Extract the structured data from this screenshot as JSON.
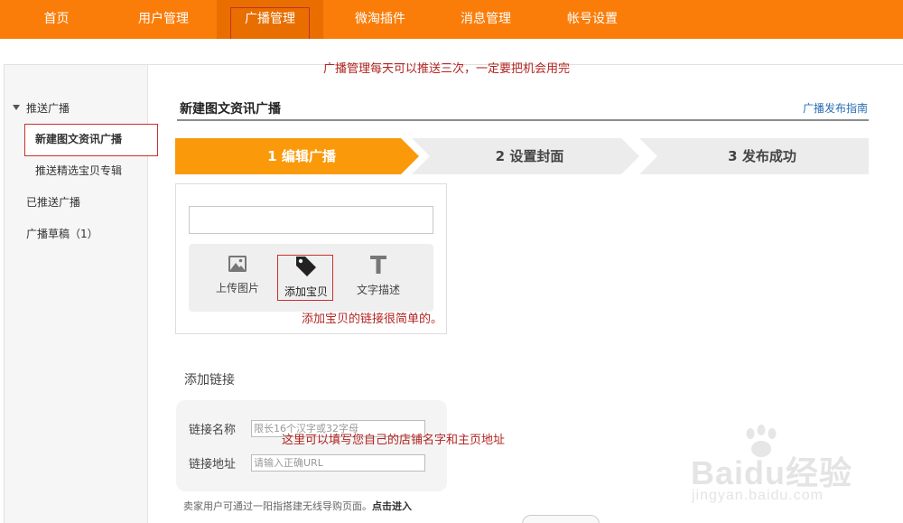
{
  "colors": {
    "accent": "#fa7d0a",
    "accent_dark": "#e86e00",
    "annotation_red": "#b22420",
    "highlight_border": "#c8302a",
    "link": "#2a6fb4",
    "step_inactive": "#ececec"
  },
  "nav": {
    "items": [
      {
        "label": "首页"
      },
      {
        "label": "用户管理"
      },
      {
        "label": "广播管理"
      },
      {
        "label": "微淘插件"
      },
      {
        "label": "消息管理"
      },
      {
        "label": "帐号设置"
      }
    ],
    "active_index": 2
  },
  "annotations": {
    "top": "广播管理每天可以推送三次，一定要把机会用完",
    "add_item": "添加宝贝的链接很简单的。",
    "link_fields": "这里可以填写您自己的店铺名字和主页地址"
  },
  "sidebar": {
    "group_label": "推送广播",
    "active_item": "新建图文资讯广播",
    "sub_item": "推送精选宝贝专辑",
    "items": [
      {
        "label": "已推送广播"
      },
      {
        "label": "广播草稿（1）"
      }
    ]
  },
  "main": {
    "title": "新建图文资讯广播",
    "guide_link": "广播发布指南",
    "steps": [
      {
        "label": "1  编辑广播",
        "active": true
      },
      {
        "label": "2  设置封面",
        "active": false
      },
      {
        "label": "3  发布成功",
        "active": false
      }
    ],
    "tools": [
      {
        "label": "上传图片",
        "icon": "image-icon"
      },
      {
        "label": "添加宝贝",
        "icon": "tag-icon"
      },
      {
        "label": "文字描述",
        "icon": "text-icon"
      }
    ],
    "add_link": {
      "title": "添加链接",
      "name_label": "链接名称",
      "name_placeholder": "限长16个汉字或32字母",
      "url_label": "链接地址",
      "url_placeholder": "请输入正确URL"
    },
    "footer_note": "卖家用户可通过一阳指搭建无线导购页面。",
    "footer_link": "点击进入"
  },
  "watermark": {
    "brand": "Baidu经验",
    "url": "jingyan.baidu.com"
  }
}
